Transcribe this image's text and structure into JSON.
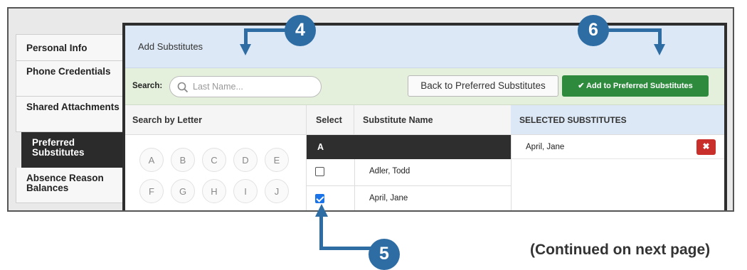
{
  "tabs": [
    {
      "label": "Personal Info"
    },
    {
      "label": "Phone Credentials"
    },
    {
      "label": "Shared Attachments"
    },
    {
      "label": "Preferred Substitutes"
    },
    {
      "label": "Absence Reason Balances"
    }
  ],
  "panel": {
    "title": "Add Substitutes"
  },
  "search": {
    "label": "Search:",
    "placeholder": "Last Name..."
  },
  "buttons": {
    "back": "Back to Preferred Substitutes",
    "add": "✔ Add to Preferred Substitutes"
  },
  "columns": {
    "letter": "Search by Letter",
    "select": "Select",
    "name": "Substitute Name",
    "selected": "SELECTED SUBSTITUTES"
  },
  "letters": [
    "A",
    "B",
    "C",
    "D",
    "E",
    "F",
    "G",
    "H",
    "I",
    "J"
  ],
  "group": "A",
  "substitutes": [
    {
      "name": "Adler, Todd",
      "checked": false
    },
    {
      "name": "April, Jane",
      "checked": true
    }
  ],
  "selected": [
    {
      "name": "April, Jane",
      "remove": "✖"
    }
  ],
  "callouts": {
    "four": "4",
    "five": "5",
    "six": "6"
  },
  "footer": "(Continued on next page)",
  "colors": {
    "accent": "#2e6da4",
    "add_button": "#2e8b3e",
    "remove_button": "#c9302c"
  }
}
